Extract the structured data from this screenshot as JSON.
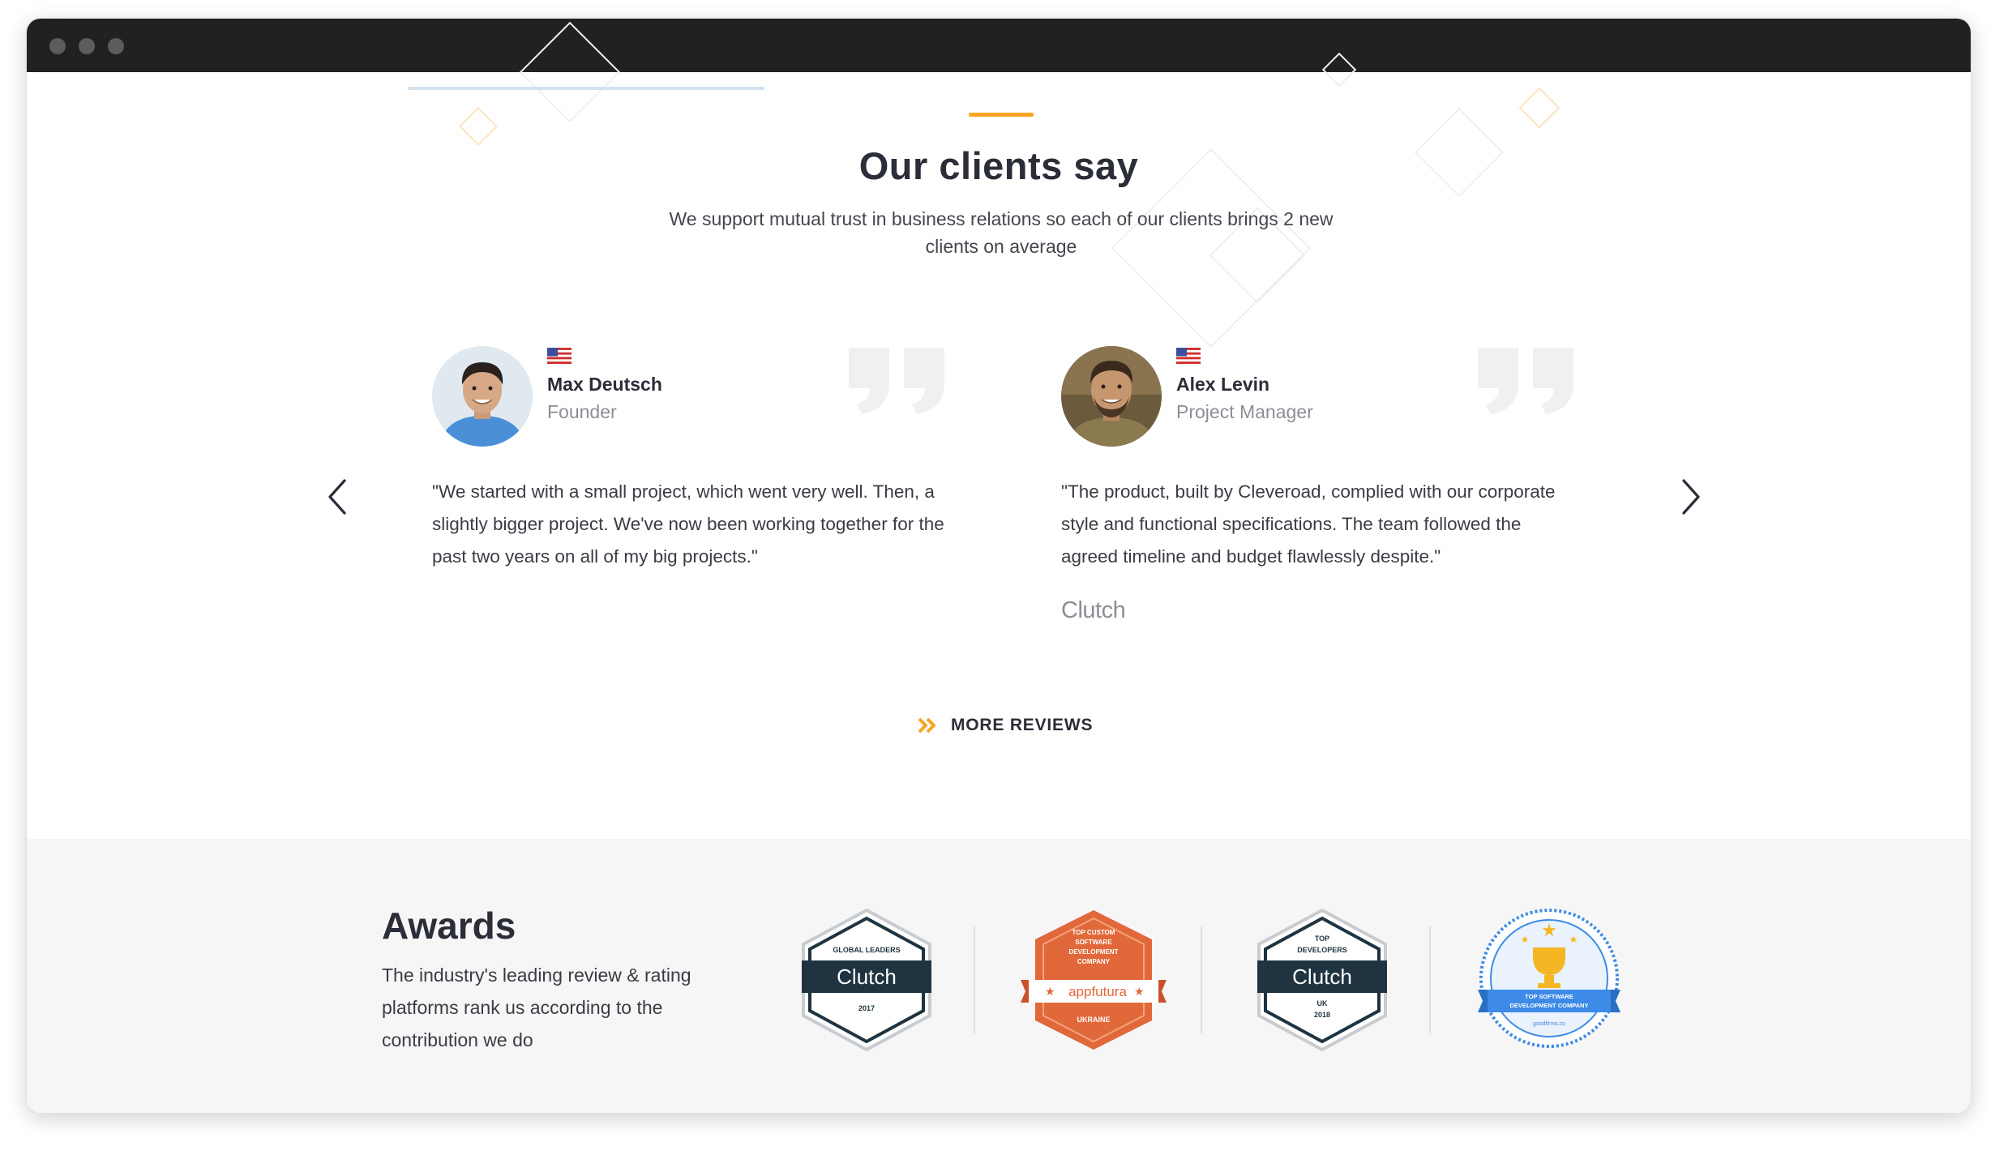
{
  "section": {
    "title": "Our clients say",
    "subtitle": "We support mutual trust in business relations so each of our clients brings 2 new clients on average"
  },
  "reviews": [
    {
      "name": "Max Deutsch",
      "role": "Founder",
      "text": "\"We started with a small project, which went very well. Then, a slightly bigger project. We've now been working together for the past two years on all of my big projects.\"",
      "source": ""
    },
    {
      "name": "Alex Levin",
      "role": "Project Manager",
      "text": "\"The product, built by Cleveroad, complied with our corporate style and functional specifications. The team followed the agreed timeline and budget flawlessly despite.\"",
      "source": "Clutch"
    }
  ],
  "more_reviews": {
    "label": "MORE REVIEWS"
  },
  "awards": {
    "title": "Awards",
    "description": "The industry's leading review & rating platforms rank us according to the contribution we do",
    "badges": [
      {
        "top": "GLOBAL LEADERS",
        "name": "Clutch",
        "bottom": "2017"
      },
      {
        "top": "TOP CUSTOM SOFTWARE DEVELOPMENT COMPANY",
        "name": "appfutura",
        "bottom": "UKRAINE"
      },
      {
        "top": "TOP DEVELOPERS",
        "name": "Clutch",
        "bottom": "UK 2018"
      },
      {
        "top": "",
        "name": "TOP SOFTWARE DEVELOPMENT COMPANY",
        "bottom": "goodfirms.co"
      }
    ]
  },
  "colors": {
    "accent": "#f5a623",
    "titlebar": "#212121",
    "text_dark": "#2b2d38",
    "text_muted": "#8c8e96",
    "awards_bg": "#f6f6f6",
    "clutch_dark": "#1f3340",
    "appfutura_orange": "#e0683a",
    "goodfirms_blue": "#3d8be6"
  },
  "icons": {
    "prev": "chevron-left-icon",
    "next": "chevron-right-icon",
    "more": "double-chevron-right-icon",
    "flag": "us-flag-icon",
    "quote": "quote-mark-icon"
  }
}
